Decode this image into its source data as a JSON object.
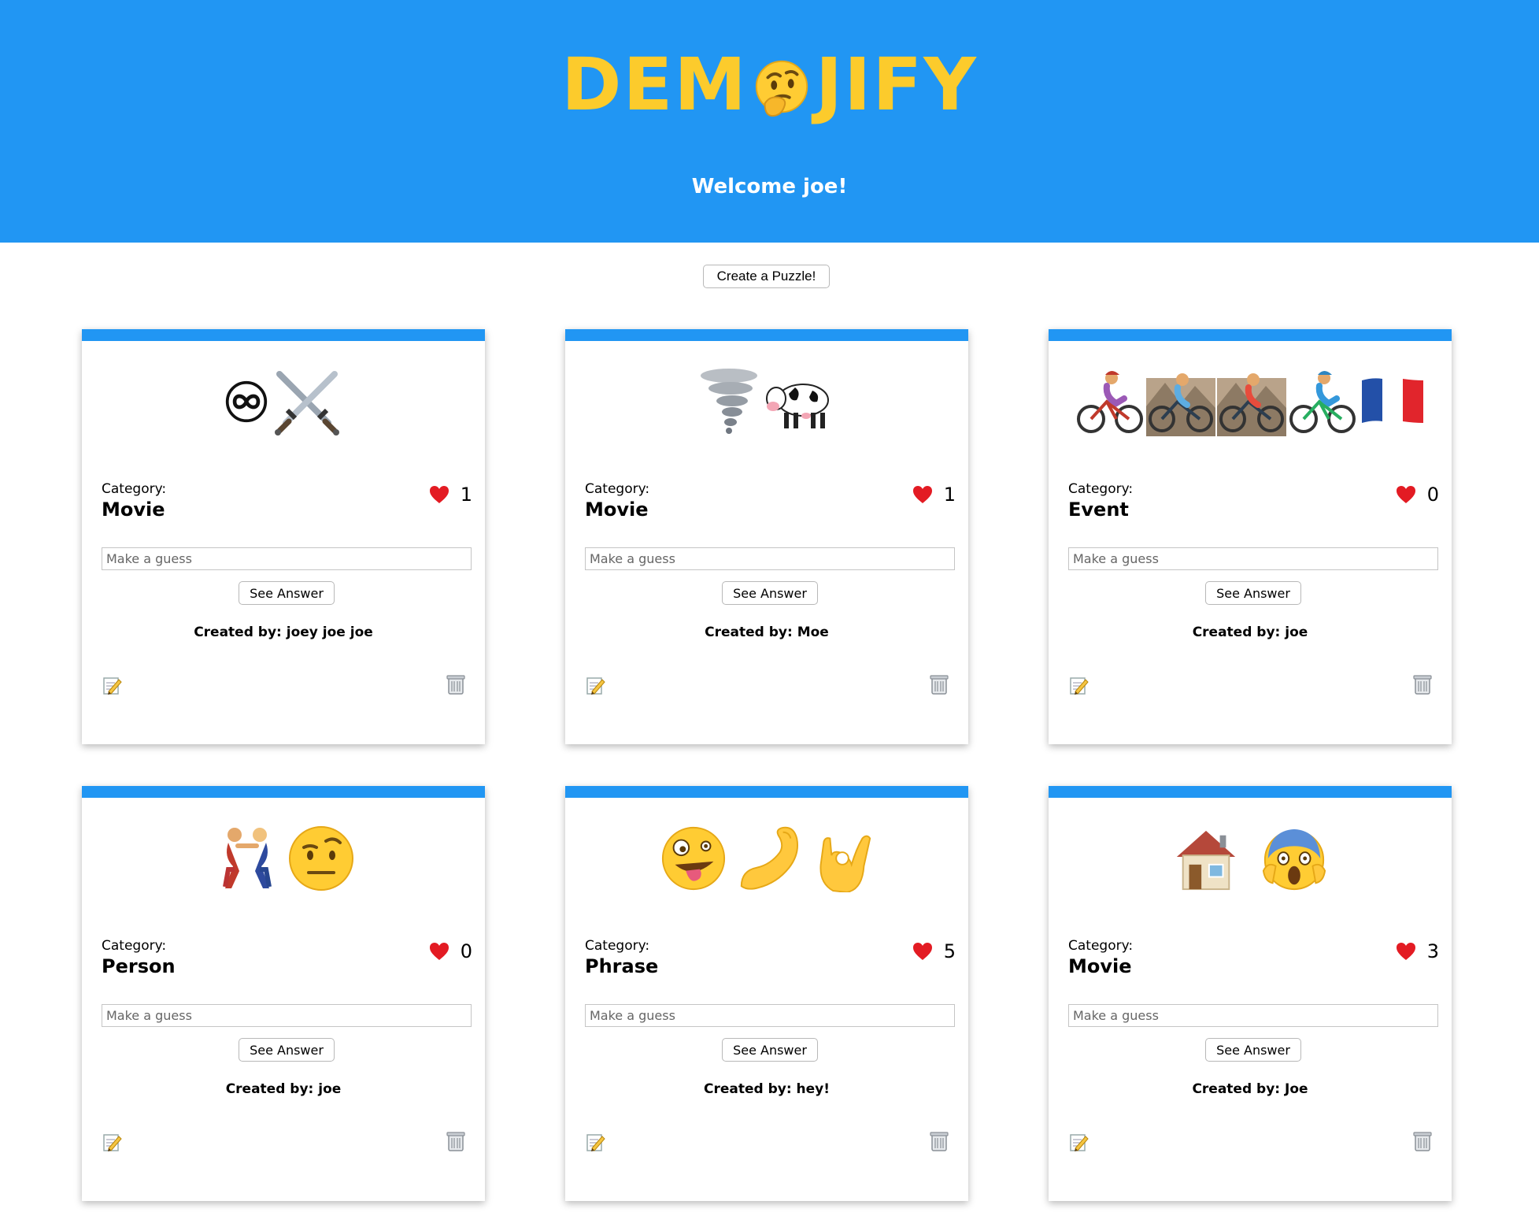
{
  "header": {
    "logo_left": "DEM",
    "logo_right": "JIFY",
    "logo_face_icon": "thinking-face-icon",
    "welcome": "Welcome joe!"
  },
  "actions": {
    "create_label": "Create a Puzzle!"
  },
  "colors": {
    "brand_blue": "#2196f3",
    "logo_yellow": "#fccb2c"
  },
  "puzzles": [
    {
      "emojis": [
        "infinity-icon",
        "crossed-swords-icon"
      ],
      "category_label": "Category:",
      "category": "Movie",
      "likes": "1",
      "guess_placeholder": "Make a guess",
      "see_answer": "See Answer",
      "created_by": "Created by: joey joe joe"
    },
    {
      "emojis": [
        "tornado-icon",
        "cow-icon"
      ],
      "category_label": "Category:",
      "category": "Movie",
      "likes": "1",
      "guess_placeholder": "Make a guess",
      "see_answer": "See Answer",
      "created_by": "Created by: Moe"
    },
    {
      "emojis": [
        "cyclist-icon",
        "mountain-cyclist-icon",
        "mountain-cyclist-icon",
        "cyclist-icon",
        "france-flag-icon"
      ],
      "category_label": "Category:",
      "category": "Event",
      "likes": "0",
      "guess_placeholder": "Make a guess",
      "see_answer": "See Answer",
      "created_by": "Created by: joe"
    },
    {
      "emojis": [
        "wrestlers-icon",
        "raised-eyebrow-face-icon"
      ],
      "category_label": "Category:",
      "category": "Person",
      "likes": "0",
      "guess_placeholder": "Make a guess",
      "see_answer": "See Answer",
      "created_by": "Created by: joe"
    },
    {
      "emojis": [
        "zany-face-icon",
        "flexed-biceps-icon",
        "ok-hand-icon"
      ],
      "category_label": "Category:",
      "category": "Phrase",
      "likes": "5",
      "guess_placeholder": "Make a guess",
      "see_answer": "See Answer",
      "created_by": "Created by: hey!"
    },
    {
      "emojis": [
        "house-icon",
        "screaming-face-icon"
      ],
      "category_label": "Category:",
      "category": "Movie",
      "likes": "3",
      "guess_placeholder": "Make a guess",
      "see_answer": "See Answer",
      "created_by": "Created by: Joe"
    }
  ]
}
